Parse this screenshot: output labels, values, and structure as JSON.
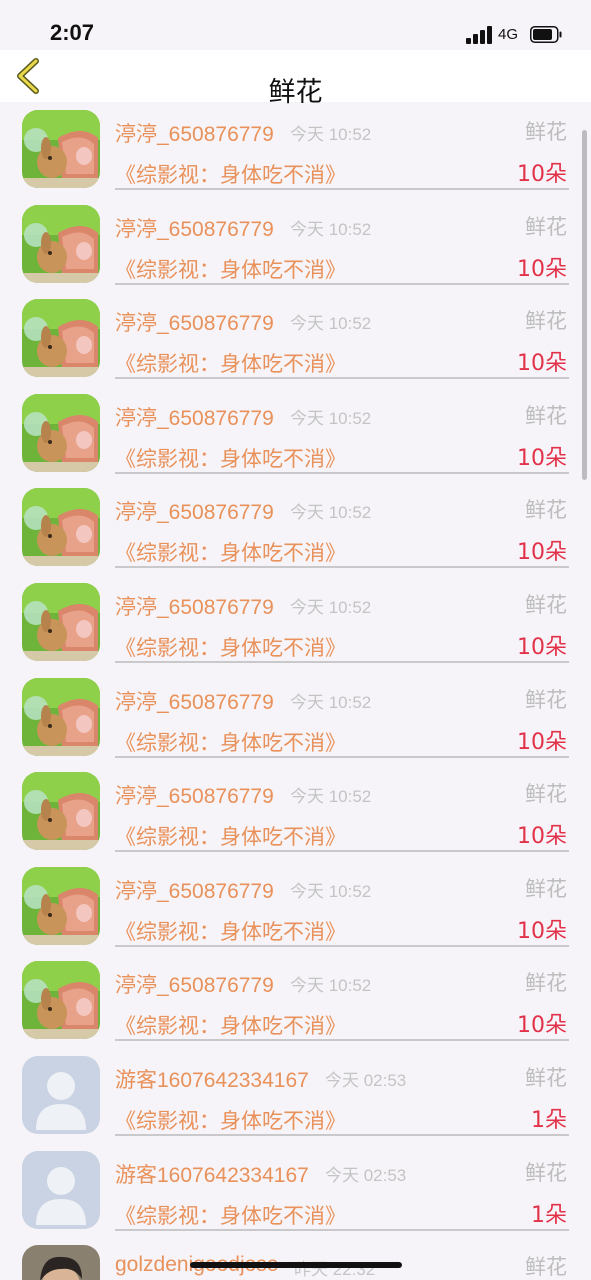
{
  "status_bar": {
    "time": "2:07",
    "network": "4G",
    "icons": [
      "signal-icon",
      "battery-icon"
    ]
  },
  "nav": {
    "title": "鲜花",
    "back_icon": "chevron-left-icon"
  },
  "colors": {
    "accent": "#e9915a",
    "count_red": "#e2324a",
    "muted": "#c4c4c4",
    "divider": "#c9c9cc"
  },
  "items": [
    {
      "avatar": "rabbit-photo-avatar",
      "username": "渟渟_650876779",
      "time": "今天 10:52",
      "gift": "鲜花",
      "title": "《综影视：身体吃不消》",
      "count": "10朵"
    },
    {
      "avatar": "rabbit-photo-avatar",
      "username": "渟渟_650876779",
      "time": "今天 10:52",
      "gift": "鲜花",
      "title": "《综影视：身体吃不消》",
      "count": "10朵"
    },
    {
      "avatar": "rabbit-photo-avatar",
      "username": "渟渟_650876779",
      "time": "今天 10:52",
      "gift": "鲜花",
      "title": "《综影视：身体吃不消》",
      "count": "10朵"
    },
    {
      "avatar": "rabbit-photo-avatar",
      "username": "渟渟_650876779",
      "time": "今天 10:52",
      "gift": "鲜花",
      "title": "《综影视：身体吃不消》",
      "count": "10朵"
    },
    {
      "avatar": "rabbit-photo-avatar",
      "username": "渟渟_650876779",
      "time": "今天 10:52",
      "gift": "鲜花",
      "title": "《综影视：身体吃不消》",
      "count": "10朵"
    },
    {
      "avatar": "rabbit-photo-avatar",
      "username": "渟渟_650876779",
      "time": "今天 10:52",
      "gift": "鲜花",
      "title": "《综影视：身体吃不消》",
      "count": "10朵"
    },
    {
      "avatar": "rabbit-photo-avatar",
      "username": "渟渟_650876779",
      "time": "今天 10:52",
      "gift": "鲜花",
      "title": "《综影视：身体吃不消》",
      "count": "10朵"
    },
    {
      "avatar": "rabbit-photo-avatar",
      "username": "渟渟_650876779",
      "time": "今天 10:52",
      "gift": "鲜花",
      "title": "《综影视：身体吃不消》",
      "count": "10朵"
    },
    {
      "avatar": "rabbit-photo-avatar",
      "username": "渟渟_650876779",
      "time": "今天 10:52",
      "gift": "鲜花",
      "title": "《综影视：身体吃不消》",
      "count": "10朵"
    },
    {
      "avatar": "rabbit-photo-avatar",
      "username": "渟渟_650876779",
      "time": "今天 10:52",
      "gift": "鲜花",
      "title": "《综影视：身体吃不消》",
      "count": "10朵"
    },
    {
      "avatar": "default-person-avatar",
      "username": "游客1607642334167",
      "time": "今天 02:53",
      "gift": "鲜花",
      "title": "《综影视：身体吃不消》",
      "count": "1朵"
    },
    {
      "avatar": "default-person-avatar",
      "username": "游客1607642334167",
      "time": "今天 02:53",
      "gift": "鲜花",
      "title": "《综影视：身体吃不消》",
      "count": "1朵"
    },
    {
      "avatar": "man-photo-avatar",
      "username": "golzdenigoodjose",
      "time": "昨天 22:32",
      "gift": "鲜花",
      "title": "",
      "count": ""
    }
  ]
}
